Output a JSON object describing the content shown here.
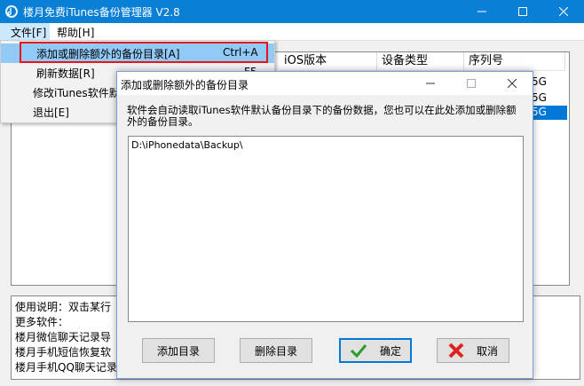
{
  "app": {
    "title": "楼月免费iTunes备份管理器 V2.8",
    "colors": {
      "titlebar": "#0a7fd6",
      "highlight_border": "#e8141a",
      "menu_hover": "#cce8ff"
    }
  },
  "menubar": {
    "file": "文件[F]",
    "help": "帮助[H]"
  },
  "file_menu": {
    "items": [
      {
        "label": "添加或删除额外的备份目录[A]",
        "shortcut": "Ctrl+A"
      },
      {
        "label": "刷新数据[R]",
        "shortcut": "F5"
      },
      {
        "label": "修改iTunes软件默",
        "shortcut": ""
      },
      {
        "label": "退出[E]",
        "shortcut": ""
      }
    ]
  },
  "main_list": {
    "columns": [
      "iOS版本",
      "设备类型",
      "序列号"
    ],
    "visible_cells": [
      "5G",
      "5G",
      "5G"
    ]
  },
  "info_box": {
    "lines": [
      "使用说明：双击某行",
      "更多软件：",
      "楼月微信聊天记录导",
      "楼月手机短信恢复软",
      "楼月手机QQ聊天记录"
    ]
  },
  "dialog": {
    "title": "添加或删除额外的备份目录",
    "description": "软件会自动读取iTunes软件默认备份目录下的备份数据，您也可以在此处添加或删除额外的备份目录。",
    "directories": [
      "D:\\iPhonedata\\Backup\\"
    ],
    "buttons": {
      "add": "添加目录",
      "delete": "删除目录",
      "ok": "确定",
      "cancel": "取消"
    }
  }
}
